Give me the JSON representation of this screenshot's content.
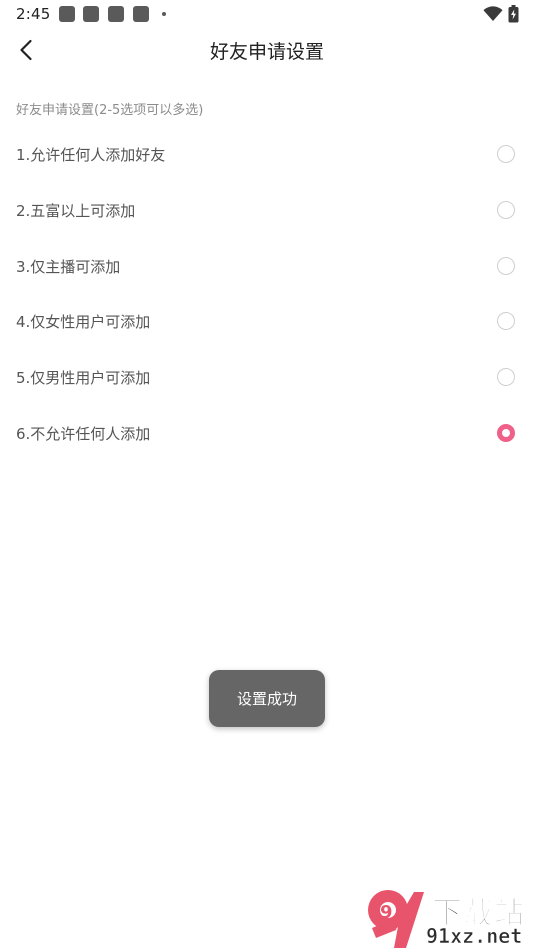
{
  "status_bar": {
    "time": "2:45",
    "icons": [
      "notification-square-icon",
      "notification-square-icon",
      "notification-square-icon",
      "notification-square-icon",
      "more-dot-icon",
      "wifi-icon",
      "battery-charging-icon"
    ]
  },
  "header": {
    "back_icon": "chevron-left-icon",
    "title": "好友申请设置"
  },
  "section": {
    "hint": "好友申请设置(2-5选项可以多选)"
  },
  "options": [
    {
      "label": "1.允许任何人添加好友",
      "checked": false
    },
    {
      "label": "2.五富以上可添加",
      "checked": false
    },
    {
      "label": "3.仅主播可添加",
      "checked": false
    },
    {
      "label": "4.仅女性用户可添加",
      "checked": false
    },
    {
      "label": "5.仅男性用户可添加",
      "checked": false
    },
    {
      "label": "6.不允许任何人添加",
      "checked": true
    }
  ],
  "toast": {
    "text": "设置成功"
  },
  "watermark": {
    "logo_text": "9",
    "title": "下载站",
    "domain": "91xz.net"
  },
  "colors": {
    "accent": "#f0618a",
    "toast_bg": "#666666",
    "hint": "#8c8c8c",
    "radio_border": "#cfcfcf",
    "watermark_logo": "#e8546b"
  }
}
